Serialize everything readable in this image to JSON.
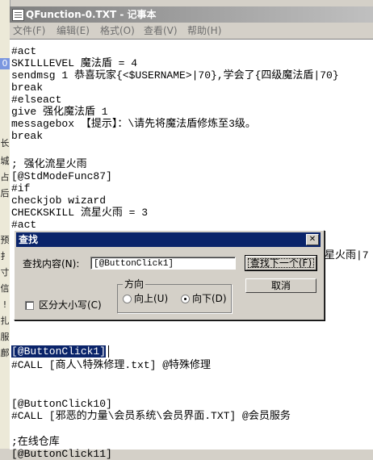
{
  "window": {
    "title": "QFunction-0.TXT - 记事本"
  },
  "menu": [
    "文件(F)",
    "编辑(E)",
    "格式(O)",
    "查看(V)",
    "帮助(H)"
  ],
  "left_strip_chars": [
    "0",
    "长",
    "城",
    "占",
    "后",
    "预",
    "扌",
    "寸",
    "信",
    "!",
    "扎",
    "服",
    "鄜"
  ],
  "lines": [
    "#act",
    "SKILLLEVEL 魔法盾 = 4",
    "sendmsg 1 恭喜玩家{<$USERNAME>|70},学会了{四级魔法盾|70}",
    "break",
    "#elseact",
    "give 强化魔法盾 1",
    "messagebox 【提示】：\\请先将魔法盾修炼至3级。",
    "break",
    "",
    "; 强化流星火雨",
    "[@StdModeFunc87]",
    "#if",
    "checkjob wizard",
    "CHECKSKILL 流星火雨 = 3",
    "#act",
    "",
    "星火雨|7",
    "",
    "",
    "",
    "",
    "",
    "",
    "",
    "[@ButtonClick1]",
    "#CALL [商人\\特殊修理.txt] @特殊修理",
    "",
    "",
    "",
    "[@ButtonClick10]",
    "#CALL [邪恶的力量\\会员系统\\会员界面.TXT] @会员服务",
    "",
    "",
    ";在线仓库",
    "[@ButtonClick11]"
  ],
  "find_dialog": {
    "title": "查找",
    "close": "✕",
    "find_label": "查找内容(N):",
    "find_value": "[@ButtonClick1]",
    "find_next": "查找下一个(F)",
    "cancel": "取消",
    "direction_label": "方向",
    "up_label": "向上(U)",
    "down_label": "向下(D)",
    "match_case_label": "区分大小写(C)",
    "direction_selected": "down",
    "match_case_checked": false
  }
}
